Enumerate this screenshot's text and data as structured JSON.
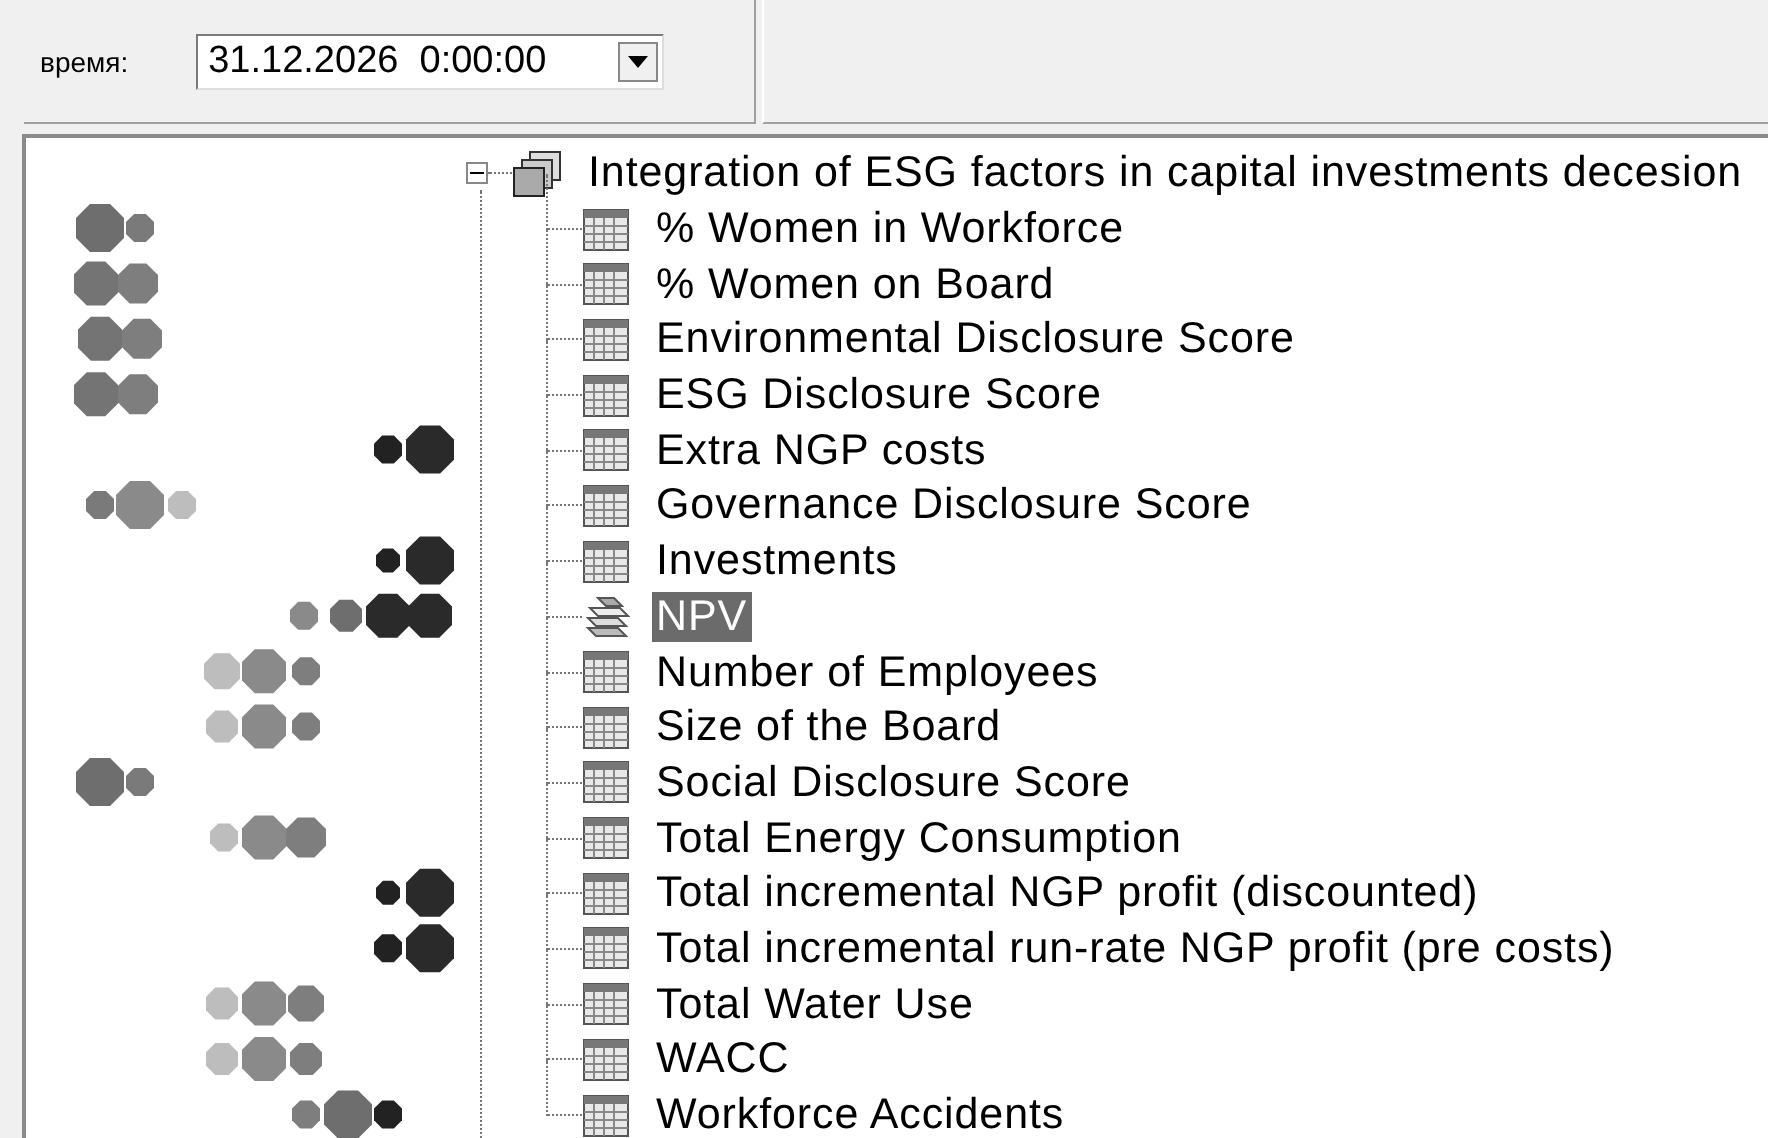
{
  "toolbar": {
    "label": "время:",
    "datetime": {
      "value": "31.12.2026  0:00:00"
    }
  },
  "tree": {
    "root": {
      "label": "Integration of ESG factors in capital investments decesion",
      "expanded": true,
      "children": [
        {
          "label": "% Women in Workforce",
          "kind": "table",
          "selected": false
        },
        {
          "label": "% Women on Board",
          "kind": "table",
          "selected": false
        },
        {
          "label": "Environmental Disclosure Score",
          "kind": "table",
          "selected": false
        },
        {
          "label": "ESG Disclosure Score",
          "kind": "table",
          "selected": false
        },
        {
          "label": "Extra NGP costs",
          "kind": "table",
          "selected": false
        },
        {
          "label": "Governance Disclosure Score",
          "kind": "table",
          "selected": false
        },
        {
          "label": "Investments",
          "kind": "table",
          "selected": false
        },
        {
          "label": "NPV",
          "kind": "stack",
          "selected": true
        },
        {
          "label": "Number of Employees",
          "kind": "table",
          "selected": false
        },
        {
          "label": "Size of the Board",
          "kind": "table",
          "selected": false
        },
        {
          "label": "Social Disclosure Score",
          "kind": "table",
          "selected": false
        },
        {
          "label": "Total Energy Consumption",
          "kind": "table",
          "selected": false
        },
        {
          "label": "Total incremental NGP profit (discounted)",
          "kind": "table",
          "selected": false
        },
        {
          "label": "Total incremental run-rate NGP profit (pre costs)",
          "kind": "table",
          "selected": false
        },
        {
          "label": "Total Water Use",
          "kind": "table",
          "selected": false
        },
        {
          "label": "WACC",
          "kind": "table",
          "selected": false
        },
        {
          "label": "Workforce Accidents",
          "kind": "table",
          "selected": false
        }
      ]
    }
  }
}
